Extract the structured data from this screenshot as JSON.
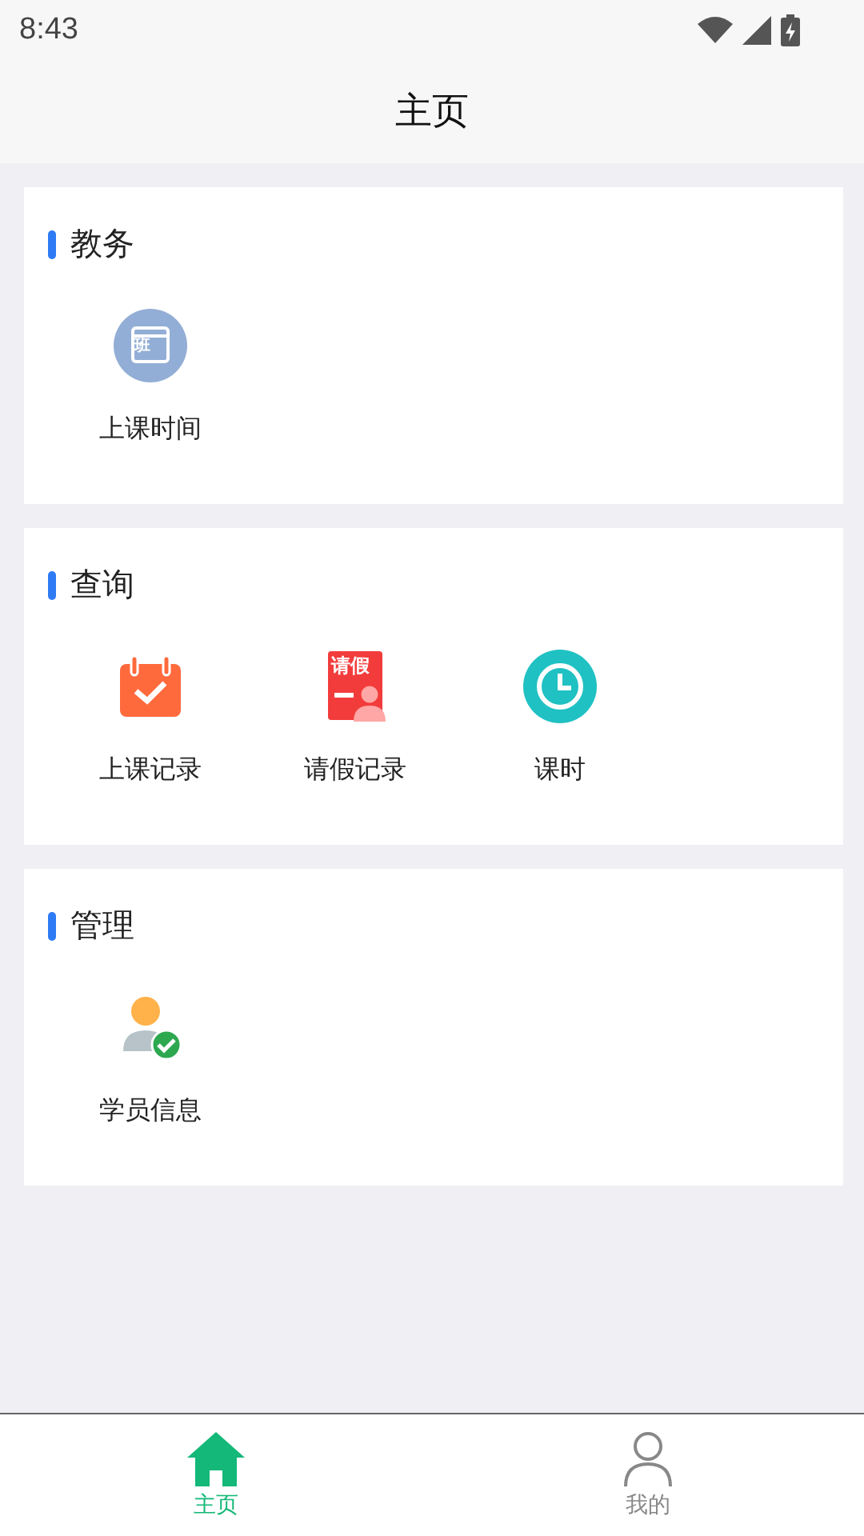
{
  "status_bar": {
    "time": "8:43"
  },
  "header": {
    "title": "主页"
  },
  "sections": [
    {
      "title": "教务",
      "items": [
        {
          "label": "上课时间",
          "kind": "class-calendar",
          "icon_text": "班"
        }
      ]
    },
    {
      "title": "查询",
      "items": [
        {
          "label": "上课记录",
          "kind": "check-calendar"
        },
        {
          "label": "请假记录",
          "kind": "leave",
          "icon_text": "请假"
        },
        {
          "label": "课时",
          "kind": "clock"
        }
      ]
    },
    {
      "title": "管理",
      "items": [
        {
          "label": "学员信息",
          "kind": "student"
        }
      ]
    }
  ],
  "tabs": [
    {
      "label": "主页",
      "kind": "home",
      "selected": true
    },
    {
      "label": "我的",
      "kind": "person",
      "selected": false
    }
  ]
}
